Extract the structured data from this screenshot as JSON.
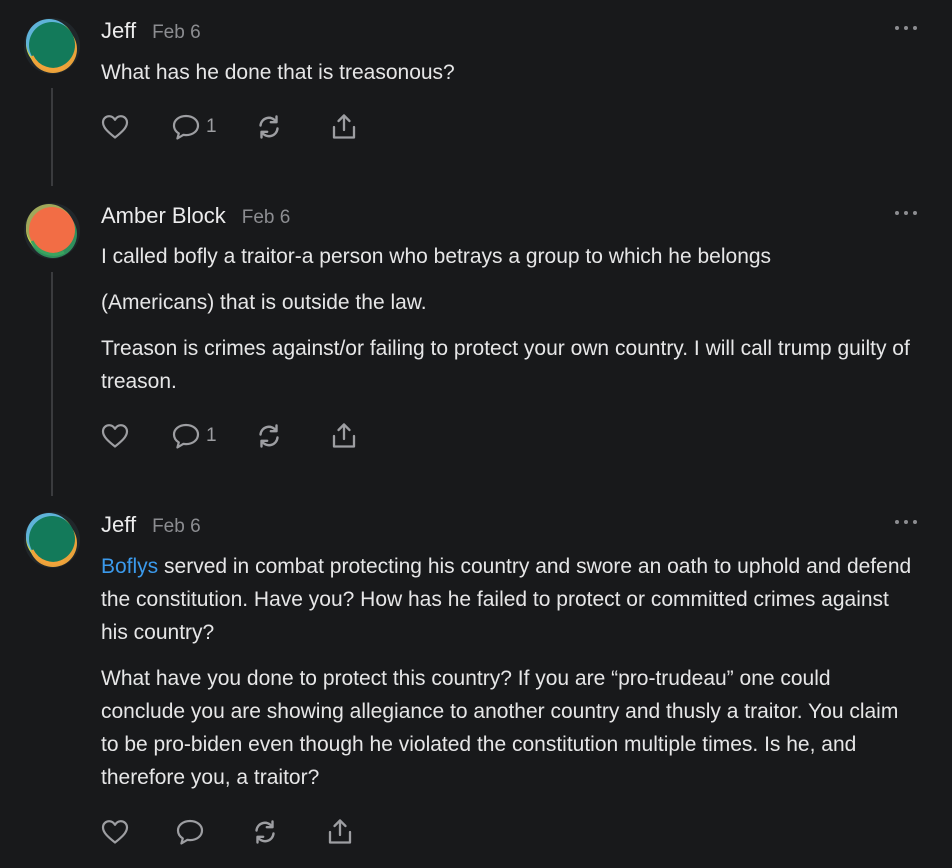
{
  "colors": {
    "background": "#18191b",
    "text": "#e6e6e7",
    "muted": "#8c8d91",
    "link": "#3b9aec",
    "thread_line": "#3a3b3e"
  },
  "comments": [
    {
      "author": "Jeff",
      "date": "Feb 6",
      "avatar": "jeff-avatar",
      "paragraphs": [
        "What has he done that is treasonous?"
      ],
      "reply_count": "1"
    },
    {
      "author": "Amber Block",
      "date": "Feb 6",
      "avatar": "amber-block-avatar",
      "paragraphs": [
        "I called bofly a traitor-a person who betrays a group to which he belongs",
        "(Americans) that is outside the law.",
        "Treason is crimes against/or failing to protect your own country. I will call trump guilty of treason."
      ],
      "reply_count": "1"
    },
    {
      "author": "Jeff",
      "date": "Feb 6",
      "avatar": "jeff-avatar",
      "mention": "Boflys",
      "paragraphs": [
        " served in combat protecting his country and swore an oath to uphold and defend the constitution. Have you? How has he failed to protect or committed crimes against his country?",
        "What have you done to protect this country? If you are “pro-trudeau” one could conclude you are showing allegiance to another country and thusly a traitor. You claim to be pro-biden even though he violated the constitution multiple times. Is he, and therefore you, a traitor?"
      ],
      "reply_count": ""
    }
  ],
  "icons": {
    "like": "heart-icon",
    "reply": "comment-icon",
    "restack": "restack-icon",
    "share": "share-icon",
    "more": "more-options-icon"
  }
}
